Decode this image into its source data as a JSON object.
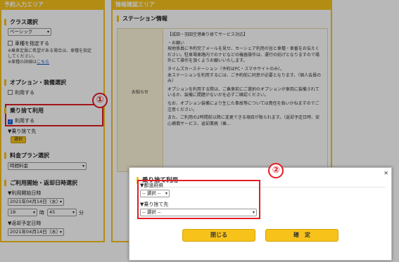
{
  "left": {
    "header": "予約入力エリア",
    "class_section": {
      "title": "クラス選択",
      "select_value": "ベーシック",
      "checkbox_label": "車種を指定する",
      "note_lines": [
        "※乗車定員に希望がある場合は、車種を指定",
        "してください。"
      ],
      "detail_prefix": "※車種の詳細は",
      "detail_link": "こちら"
    },
    "option_section": {
      "title": "オプション・装備選択",
      "checkbox_label": "利用する"
    },
    "dropoff_section": {
      "title": "乗り捨て利用",
      "checkbox_label": "利用する",
      "dest_label": "▼乗り捨て先",
      "select_button": "選択"
    },
    "price_section": {
      "title": "料金プラン選択",
      "select_value": "時間料金"
    },
    "datetime_section": {
      "title": "ご利用開始・返却日時選択",
      "start_label": "▼利用開始日時",
      "start_date": "2021年04月14日（水）",
      "start_hour": "18",
      "hour_unit": "時",
      "start_min": "45",
      "min_unit": "分",
      "return_label": "▼返却予定日時",
      "return_date": "2021年04月14日（水）"
    }
  },
  "right": {
    "header": "情報確認エリア",
    "station_title": "ステーション情報",
    "info_label": "お知らせ",
    "info_paragraphs": [
      "【成田・羽田空港乗り捨てサービス対応】",
      "・お願い\n現地係員に予約完了メールを見せ、カーシェア利用の旨と車種・車番をお伝えください。駐車場車路内でのナビなどの機器操作は、運行の妨げとなりますので場外にて操作を頂くようお願いいたします。",
      "タイムズカーステーション（予約はPC・スマホサイトのみ）。\n本ステーションを利用するには、ご予約前に同意が必要となります。（個人会員のみ）",
      "オプションを利用する際は、ご乗車前にご選択のオプションが車両に装備されているか、装備に間題がないかを必ずご確認ください。",
      "なお、オプション装備により生じた事故等については責任を負いかねますのでご注意ください。",
      "また、ご利用の2時間前以降に変更できる項目が限られます。（返却予定日時、安心補償サービス、返却業務（乗…"
    ]
  },
  "modal": {
    "title": "乗り捨て利用",
    "close_icon": "✕",
    "prefecture_label": "▼都道府県",
    "prefecture_value": "-- 選択 --",
    "dest_label": "▼乗り捨て先",
    "dest_value": "-- 選択 --",
    "close_button": "閉じる",
    "confirm_button": "確　定"
  },
  "annotations": {
    "marker1": "①",
    "marker2": "②"
  },
  "colors": {
    "accent": "#f7c31b",
    "highlight": "#e21c24",
    "link": "#0b52c2"
  }
}
